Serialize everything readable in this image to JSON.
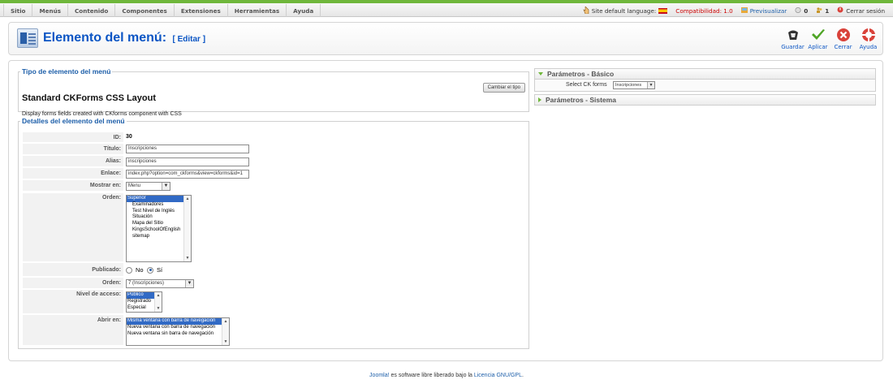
{
  "menu": [
    "Sitio",
    "Menús",
    "Contenido",
    "Componentes",
    "Extensiones",
    "Herramientas",
    "Ayuda"
  ],
  "status": {
    "site_language": "Site default language:",
    "compat": "Compatibilidad: 1.0",
    "preview": "Previsualizar",
    "messages": "0",
    "users": "1",
    "logout": "Cerrar sesión"
  },
  "header": {
    "title": "Elemento del menú:",
    "subtitle": "[ Editar ]"
  },
  "toolbar": {
    "save": "Guardar",
    "apply": "Aplicar",
    "close": "Cerrar",
    "help": "Ayuda"
  },
  "type_section": {
    "legend": "Tipo de elemento del menú",
    "title": "Standard CKForms CSS Layout",
    "description": "Display forms fields created with CKforms component with CSS",
    "change_button": "Cambiar el tipo"
  },
  "details": {
    "legend": "Detalles del elemento del menú",
    "id_label": "ID:",
    "id_value": "30",
    "title_label": "Título:",
    "title_value": "Inscripciones",
    "alias_label": "Alias:",
    "alias_value": "inscripciones",
    "link_label": "Enlace:",
    "link_value": "index.php?option=com_ckforms&view=ckforms&id=1",
    "showon_label": "Mostrar en:",
    "showon_value": "Menu",
    "parent_label": "Orden:",
    "parent_options": [
      "Superior",
      "Examinadores",
      "Test Nivel de Inglés",
      "Situación",
      "Mapa del Sitio",
      "KingsSchoolOfEnglish",
      "sitemap"
    ],
    "published_label": "Publicado:",
    "published_no": "No",
    "published_yes": "Sí",
    "order_label": "Orden:",
    "order_value": "7 (Inscripciones)",
    "access_label": "Nivel de acceso:",
    "access_options": [
      "Público",
      "Registrado",
      "Especial"
    ],
    "open_label": "Abrir en:",
    "open_options": [
      "Misma ventana con barra de navegación",
      "Nueva ventana con barra de navegación",
      "Nueva ventana sin barra de navegación"
    ]
  },
  "params": {
    "basic": "Parámetros - Básico",
    "form_label": "Select CK forms",
    "form_value": "Inscripciones",
    "system": "Parámetros - Sistema"
  },
  "footer": {
    "brand": "Joomla!",
    "text": " es software libre liberado bajo la ",
    "license": "Licencia GNU/GPL",
    "end": "."
  }
}
